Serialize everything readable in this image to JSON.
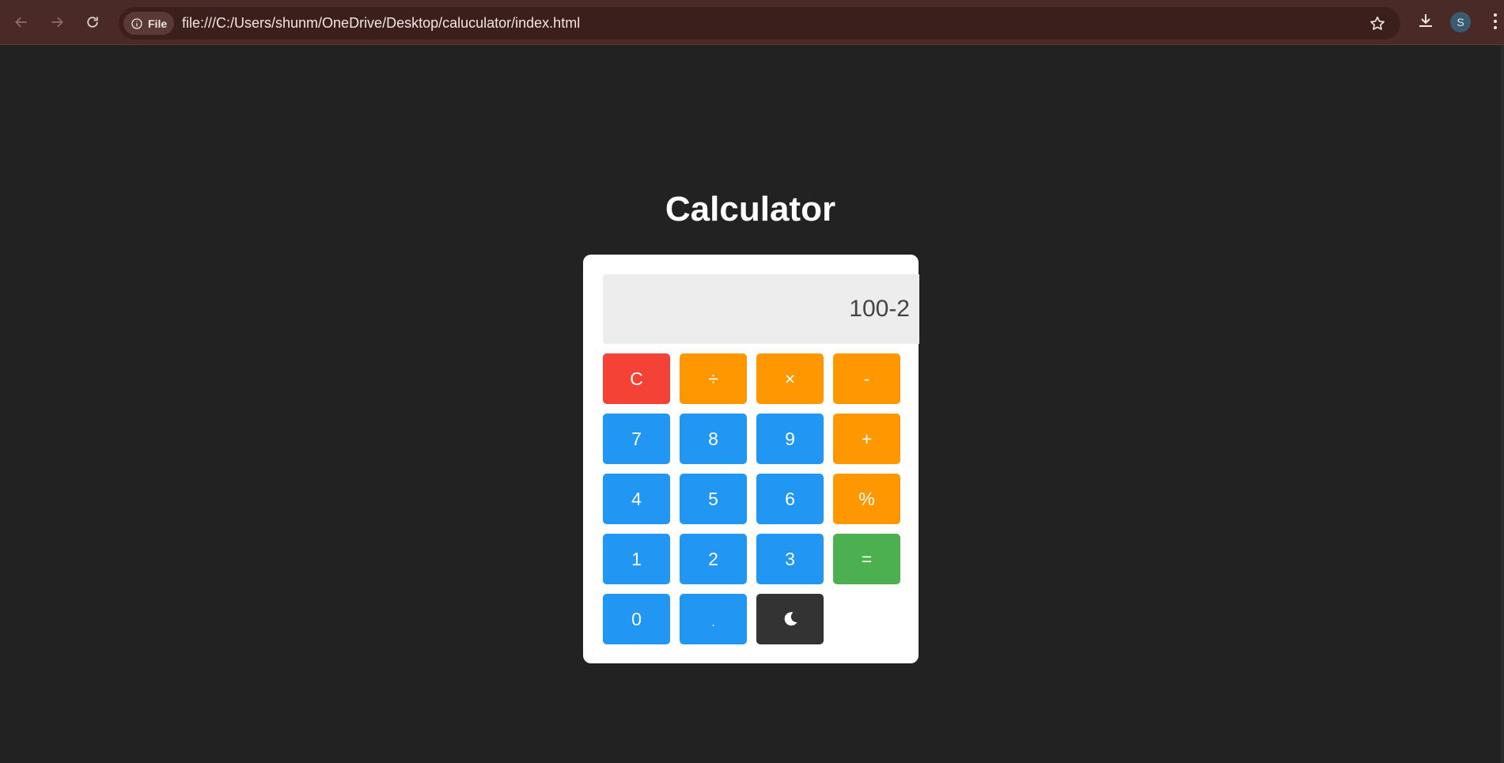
{
  "browser": {
    "site_chip_label": "File",
    "url": "file:///C:/Users/shunm/OneDrive/Desktop/caluculator/index.html",
    "avatar_initial": "S"
  },
  "page": {
    "title": "Calculator"
  },
  "calculator": {
    "display_value": "100-2",
    "keys": {
      "clear": "C",
      "divide": "÷",
      "multiply": "×",
      "minus": "-",
      "seven": "7",
      "eight": "8",
      "nine": "9",
      "plus": "+",
      "four": "4",
      "five": "5",
      "six": "6",
      "percent": "%",
      "one": "1",
      "two": "2",
      "three": "3",
      "equals": "=",
      "zero": "0",
      "decimal": "."
    }
  },
  "colors": {
    "clear": "#f44336",
    "operator": "#ff9800",
    "digit": "#2196f3",
    "equals": "#4caf50",
    "theme_toggle": "#333333",
    "background": "#222222"
  },
  "icons": {
    "theme_toggle": "moon-icon"
  }
}
